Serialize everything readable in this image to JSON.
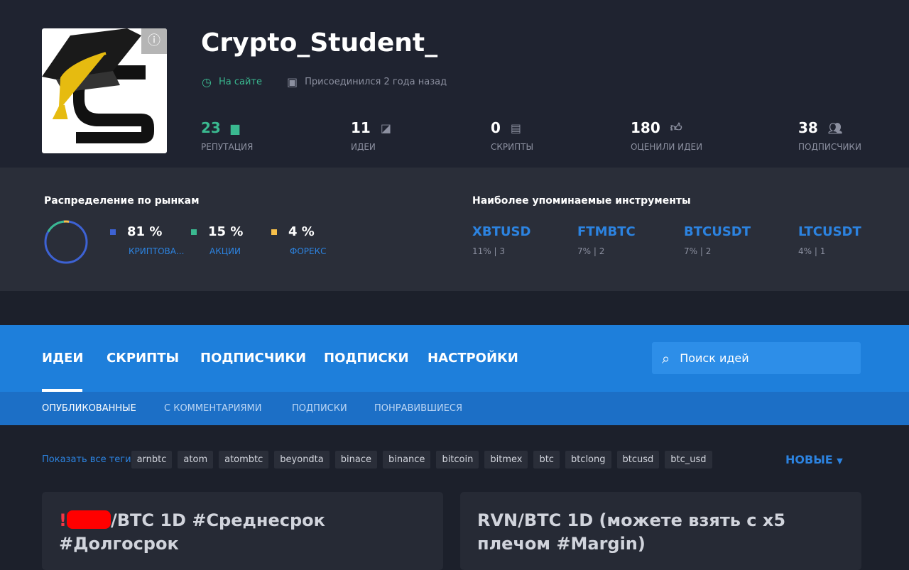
{
  "profile": {
    "username": "Crypto_Student_",
    "status": "На сайте",
    "joined": "Присоединился 2 года назад"
  },
  "stats": [
    {
      "value": "23",
      "label": "РЕПУТАЦИЯ",
      "icon": "bar-chart-icon"
    },
    {
      "value": "11",
      "label": "ИДЕИ",
      "icon": "line-chart-icon"
    },
    {
      "value": "0",
      "label": "СКРИПТЫ",
      "icon": "document-icon"
    },
    {
      "value": "180",
      "label": "ОЦЕНИЛИ ИДЕИ",
      "icon": "thumbs-up-icon"
    },
    {
      "value": "38",
      "label": "ПОДПИСЧИКИ",
      "icon": "people-icon"
    }
  ],
  "markets": {
    "title": "Распределение по рынкам",
    "items": [
      {
        "value": "81 %",
        "label": "КРИПТОВА...",
        "color": "#3d62d4",
        "fraction": 0.81
      },
      {
        "value": "15 %",
        "label": "АКЦИИ",
        "color": "#3ab990",
        "fraction": 0.15
      },
      {
        "value": "4 %",
        "label": "ФОРЕКС",
        "color": "#f7c04a",
        "fraction": 0.04
      }
    ]
  },
  "instruments": {
    "title": "Наиболее упоминаемые инструменты",
    "items": [
      {
        "symbol": "XBTUSD",
        "info": "11% | 3"
      },
      {
        "symbol": "FTMBTC",
        "info": "7% | 2"
      },
      {
        "symbol": "BTCUSDT",
        "info": "7% | 2"
      },
      {
        "symbol": "LTCUSDT",
        "info": "4% | 1"
      }
    ]
  },
  "nav": {
    "tabs": [
      "ИДЕИ",
      "СКРИПТЫ",
      "ПОДПИСЧИКИ",
      "ПОДПИСКИ",
      "НАСТРОЙКИ"
    ],
    "search_placeholder": "Поиск идей"
  },
  "subnav": [
    "ОПУБЛИКОВАННЫЕ",
    "С КОММЕНТАРИЯМИ",
    "ПОДПИСКИ",
    "ПОНРАВИВШИЕСЯ"
  ],
  "tags": {
    "show_all": "Показать все теги",
    "items": [
      "arnbtc",
      "atom",
      "atombtc",
      "beyondta",
      "binace",
      "binance",
      "bitcoin",
      "bitmex",
      "btc",
      "btclong",
      "btcusd",
      "btc_usd"
    ]
  },
  "sort": "НОВЫЕ",
  "cards": [
    {
      "prefix": "!",
      "title": "/BTC 1D #Среднесрок #Долгосрок"
    },
    {
      "title": "RVN/BTC 1D (можете взять с x5 плечом #Margin)"
    }
  ]
}
